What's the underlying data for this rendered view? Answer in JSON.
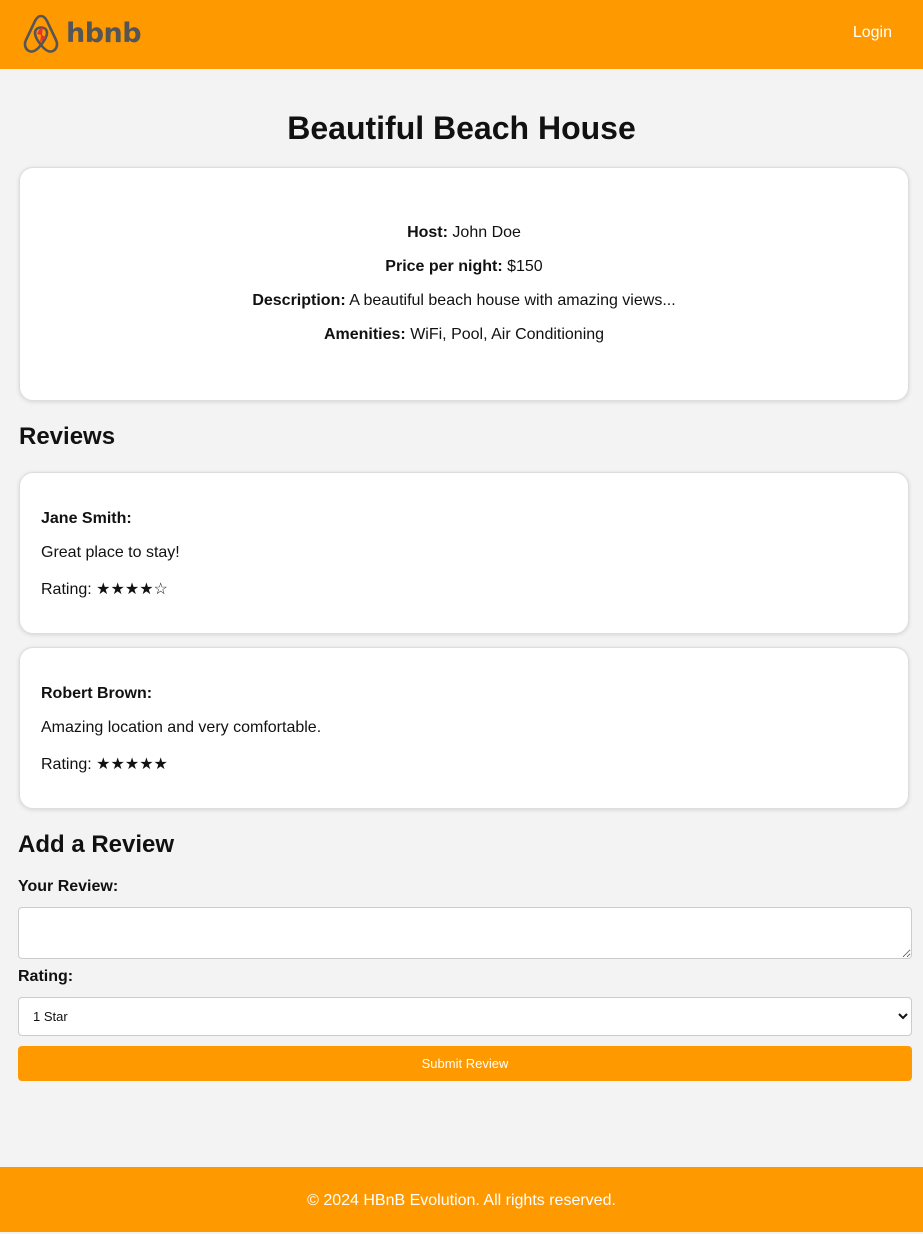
{
  "header": {
    "logo_text": "hbnb",
    "login_label": "Login",
    "brand_color": "#ff9900",
    "logo_icon": "airbnb-logo-icon"
  },
  "place": {
    "title": "Beautiful Beach House",
    "host_label": "Host:",
    "host": "John Doe",
    "price_label": "Price per night:",
    "price": "$150",
    "description_label": "Description:",
    "description": "A beautiful beach house with amazing views...",
    "amenities_label": "Amenities:",
    "amenities": "WiFi, Pool, Air Conditioning"
  },
  "reviews": {
    "title": "Reviews",
    "items": [
      {
        "author": "Jane Smith:",
        "comment": "Great place to stay!",
        "rating_label": "Rating:",
        "stars": "★★★★☆",
        "rating": 4
      },
      {
        "author": "Robert Brown:",
        "comment": "Amazing location and very comfortable.",
        "rating_label": "Rating:",
        "stars": "★★★★★",
        "rating": 5
      }
    ]
  },
  "add_review": {
    "title": "Add a Review",
    "review_label": "Your Review:",
    "review_value": "",
    "rating_label": "Rating:",
    "rating_selected": "1 Star",
    "submit_label": "Submit Review"
  },
  "footer": {
    "text": "© 2024 HBnB Evolution. All rights reserved."
  }
}
